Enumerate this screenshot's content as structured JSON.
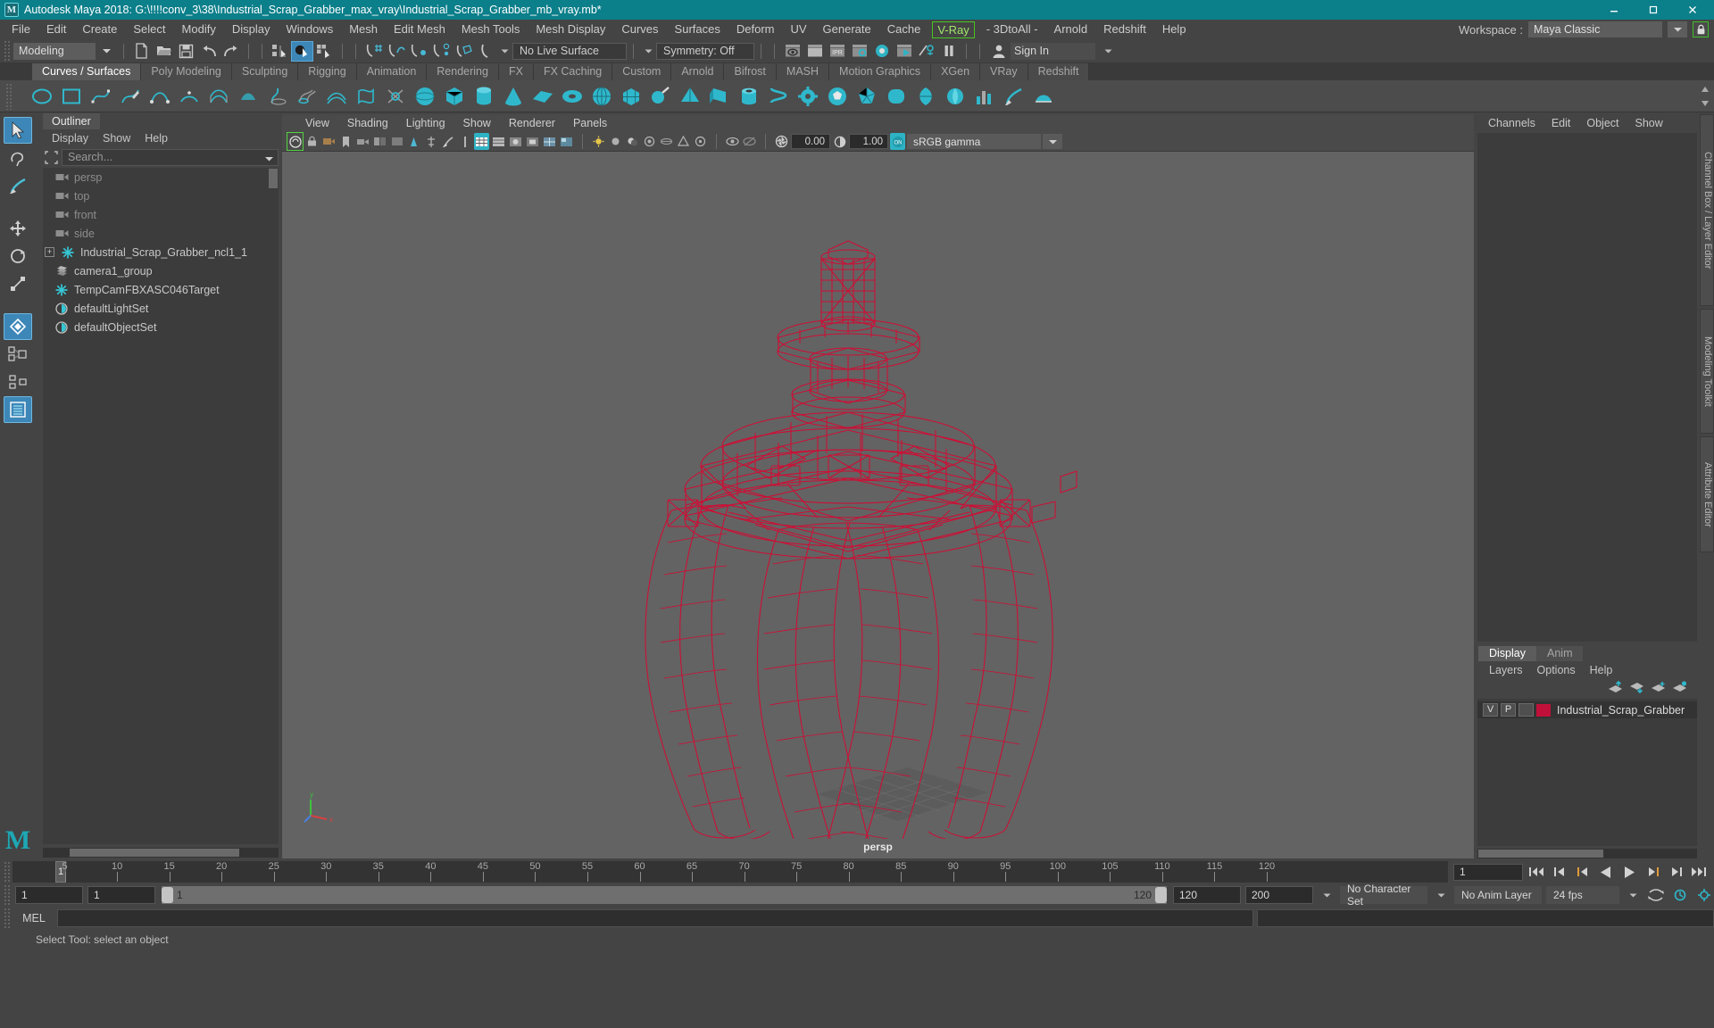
{
  "window": {
    "title": "Autodesk Maya 2018: G:\\!!!!conv_3\\38\\Industrial_Scrap_Grabber_max_vray\\Industrial_Scrap_Grabber_mb_vray.mb*",
    "logo_letter": "M",
    "minimize": "minimize-button",
    "maximize": "maximize-button",
    "close": "close-button"
  },
  "menubar": {
    "items": [
      {
        "label": "File",
        "boxed": false
      },
      {
        "label": "Edit",
        "boxed": false
      },
      {
        "label": "Create",
        "boxed": false
      },
      {
        "label": "Select",
        "boxed": false
      },
      {
        "label": "Modify",
        "boxed": false
      },
      {
        "label": "Display",
        "boxed": false
      },
      {
        "label": "Windows",
        "boxed": false
      },
      {
        "label": "Mesh",
        "boxed": false
      },
      {
        "label": "Edit Mesh",
        "boxed": false
      },
      {
        "label": "Mesh Tools",
        "boxed": false
      },
      {
        "label": "Mesh Display",
        "boxed": false
      },
      {
        "label": "Curves",
        "boxed": false
      },
      {
        "label": "Surfaces",
        "boxed": false
      },
      {
        "label": "Deform",
        "boxed": false
      },
      {
        "label": "UV",
        "boxed": false
      },
      {
        "label": "Generate",
        "boxed": false
      },
      {
        "label": "Cache",
        "boxed": false
      },
      {
        "label": "V-Ray",
        "boxed": true
      },
      {
        "label": "- 3DtoAll -",
        "boxed": false
      },
      {
        "label": "Arnold",
        "boxed": false
      },
      {
        "label": "Redshift",
        "boxed": false
      },
      {
        "label": "Help",
        "boxed": false
      }
    ],
    "workspace_label": "Workspace :",
    "workspace_value": "Maya Classic"
  },
  "statusbar": {
    "mode": "Modeling",
    "live_surface": "No Live Surface",
    "symmetry": "Symmetry: Off",
    "sign_in": "Sign In"
  },
  "shelf": {
    "tabs": [
      {
        "label": "Curves / Surfaces",
        "active": true
      },
      {
        "label": "Poly Modeling",
        "active": false
      },
      {
        "label": "Sculpting",
        "active": false
      },
      {
        "label": "Rigging",
        "active": false
      },
      {
        "label": "Animation",
        "active": false
      },
      {
        "label": "Rendering",
        "active": false
      },
      {
        "label": "FX",
        "active": false
      },
      {
        "label": "FX Caching",
        "active": false
      },
      {
        "label": "Custom",
        "active": false
      },
      {
        "label": "Arnold",
        "active": false
      },
      {
        "label": "Bifrost",
        "active": false
      },
      {
        "label": "MASH",
        "active": false
      },
      {
        "label": "Motion Graphics",
        "active": false
      },
      {
        "label": "XGen",
        "active": false
      },
      {
        "label": "VRay",
        "active": false
      },
      {
        "label": "Redshift",
        "active": false
      }
    ]
  },
  "outliner": {
    "tab": "Outliner",
    "menu": [
      "Display",
      "Show",
      "Help"
    ],
    "search_placeholder": "Search...",
    "items": [
      {
        "label": "persp",
        "icon": "camera-icon",
        "dim": true,
        "expand": false
      },
      {
        "label": "top",
        "icon": "camera-icon",
        "dim": true,
        "expand": false
      },
      {
        "label": "front",
        "icon": "camera-icon",
        "dim": true,
        "expand": false
      },
      {
        "label": "side",
        "icon": "camera-icon",
        "dim": true,
        "expand": false
      },
      {
        "label": "Industrial_Scrap_Grabber_ncl1_1",
        "icon": "transform-icon",
        "dim": false,
        "expand": true
      },
      {
        "label": "camera1_group",
        "icon": "group-icon",
        "dim": false,
        "expand": false
      },
      {
        "label": "TempCamFBXASC046Target",
        "icon": "transform-icon",
        "dim": false,
        "expand": false
      },
      {
        "label": "defaultLightSet",
        "icon": "set-icon",
        "dim": false,
        "expand": false
      },
      {
        "label": "defaultObjectSet",
        "icon": "set-icon",
        "dim": false,
        "expand": false
      }
    ]
  },
  "viewport": {
    "menu": [
      "View",
      "Shading",
      "Lighting",
      "Show",
      "Renderer",
      "Panels"
    ],
    "exposure": "0.00",
    "gamma": "1.00",
    "color_space": "sRGB gamma",
    "camera_label": "persp",
    "wire_color": "#d40a33",
    "background_color": "#636363"
  },
  "channelbox": {
    "menu": [
      "Channels",
      "Edit",
      "Object",
      "Show"
    ],
    "vtabs": [
      "Channel Box / Layer Editor",
      "Modeling Toolkit",
      "Attribute Editor"
    ]
  },
  "layers": {
    "tabs": [
      {
        "label": "Display",
        "active": true
      },
      {
        "label": "Anim",
        "active": false
      }
    ],
    "menu": [
      "Layers",
      "Options",
      "Help"
    ],
    "rows": [
      {
        "v": "V",
        "p": "P",
        "swatch_color": "#c0103a",
        "name": "Industrial_Scrap_Grabber"
      }
    ]
  },
  "timeline": {
    "ticks": [
      5,
      10,
      15,
      20,
      25,
      30,
      35,
      40,
      45,
      50,
      55,
      60,
      65,
      70,
      75,
      80,
      85,
      90,
      95,
      100,
      105,
      110,
      115,
      120
    ],
    "current_frame": "1",
    "current_frame_field": "1",
    "start": "1",
    "end": "120",
    "range_start": "1",
    "range_end": "120",
    "playback_start": "1",
    "playback_end": "120",
    "anim_end_field": "120",
    "anim_total_field": "200",
    "character_set": "No Character Set",
    "anim_layer": "No Anim Layer",
    "fps": "24 fps"
  },
  "command": {
    "mel_label": "MEL",
    "mel_value": "",
    "status_text": "Select Tool: select an object"
  }
}
